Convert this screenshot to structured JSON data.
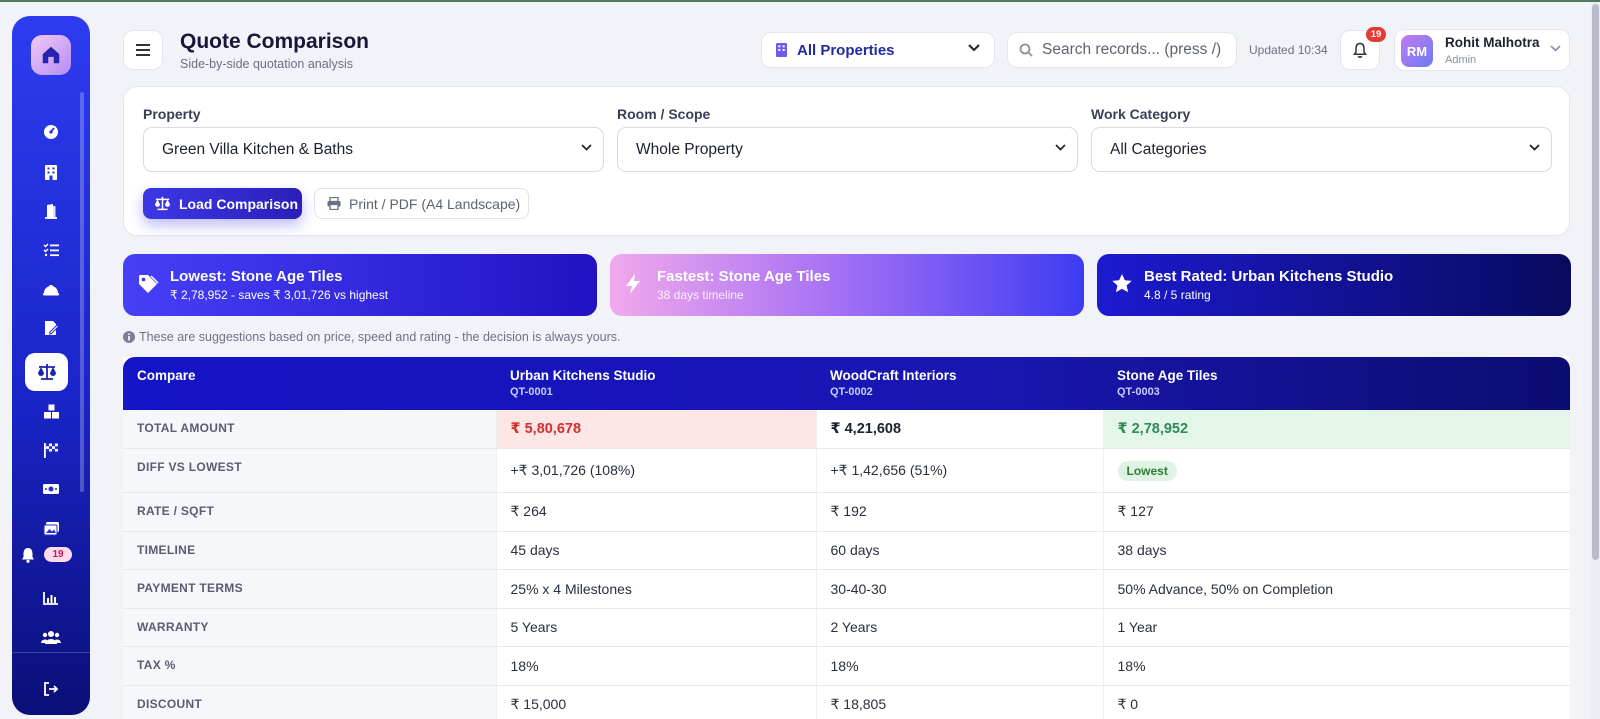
{
  "header": {
    "title": "Quote Comparison",
    "subtitle": "Side-by-side quotation analysis",
    "property_selector": "All Properties",
    "search_placeholder": "Search records... (press /)",
    "updated": "Updated 10:34",
    "notif_count": "19",
    "user": {
      "initials": "RM",
      "name": "Rohit Malhotra",
      "role": "Admin"
    }
  },
  "sidebar": {
    "icons": [
      "home-icon",
      "dashboard-icon",
      "building-icon",
      "door-icon",
      "checklist-icon",
      "hardhat-icon",
      "edit-document-icon",
      "scale-icon",
      "boxes-icon",
      "flag-icon",
      "money-icon",
      "gallery-icon",
      "bell-icon",
      "chart-icon",
      "users-icon",
      "logout-icon"
    ],
    "active": "scale-icon",
    "notif_badge": "19"
  },
  "filters": {
    "property_label": "Property",
    "property_value": "Green Villa Kitchen & Baths",
    "room_label": "Room / Scope",
    "room_value": "Whole Property",
    "category_label": "Work Category",
    "category_value": "All Categories",
    "load_button": "Load Comparison",
    "print_button": "Print / PDF (A4 Landscape)"
  },
  "highlights": [
    {
      "title": "Lowest: Stone Age Tiles",
      "sub": "₹ 2,78,952 - saves ₹ 3,01,726 vs highest",
      "icon": "tag-icon"
    },
    {
      "title": "Fastest: Stone Age Tiles",
      "sub": "38 days timeline",
      "icon": "lightning-icon"
    },
    {
      "title": "Best Rated: Urban Kitchens Studio",
      "sub": "4.8 / 5 rating",
      "icon": "star-icon"
    }
  ],
  "note": "These are suggestions based on price, speed and rating - the decision is always yours.",
  "table": {
    "compare_header": "Compare",
    "vendors": [
      {
        "name": "Urban Kitchens Studio",
        "code": "QT-0001"
      },
      {
        "name": "WoodCraft Interiors",
        "code": "QT-0002"
      },
      {
        "name": "Stone Age Tiles",
        "code": "QT-0003"
      }
    ],
    "rows": [
      {
        "label": "TOTAL AMOUNT",
        "values": [
          "₹ 5,80,678",
          "₹ 4,21,608",
          "₹ 2,78,952"
        ]
      },
      {
        "label": "DIFF VS LOWEST",
        "values": [
          "+₹ 3,01,726 (108%)",
          "+₹ 1,42,656 (51%)",
          "Lowest"
        ]
      },
      {
        "label": "RATE / SQFT",
        "values": [
          "₹ 264",
          "₹ 192",
          "₹ 127"
        ]
      },
      {
        "label": "TIMELINE",
        "values": [
          "45 days",
          "60 days",
          "38 days"
        ]
      },
      {
        "label": "PAYMENT TERMS",
        "values": [
          "25% x 4 Milestones",
          "30-40-30",
          "50% Advance, 50% on Completion"
        ]
      },
      {
        "label": "WARRANTY",
        "values": [
          "5 Years",
          "2 Years",
          "1 Year"
        ]
      },
      {
        "label": "TAX %",
        "values": [
          "18%",
          "18%",
          "18%"
        ]
      },
      {
        "label": "DISCOUNT",
        "values": [
          "₹ 15,000",
          "₹ 18,805",
          "₹ 0"
        ]
      }
    ]
  },
  "colors": {
    "accent": "#2d3cf0",
    "high": "#d32f2f",
    "low": "#2e8b57"
  }
}
